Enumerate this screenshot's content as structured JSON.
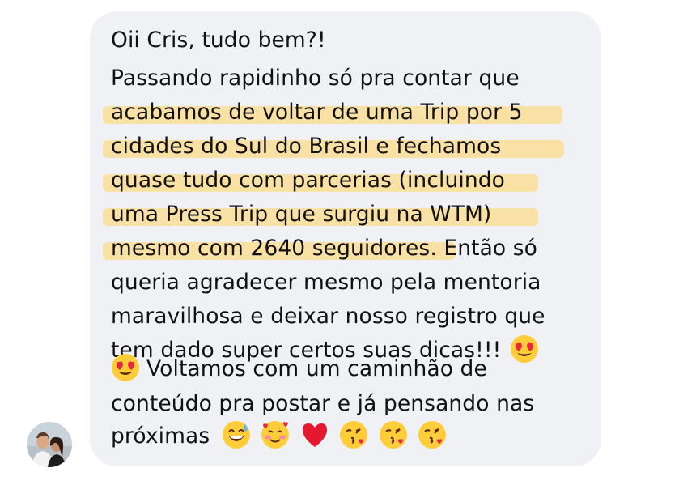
{
  "message": {
    "line1": "Oii Cris, tudo bem?!",
    "line2": "Passando rapidinho só pra contar que",
    "line3": "acabamos de voltar de uma Trip por 5",
    "line4": "cidades do Sul do Brasil e fechamos",
    "line5": "quase tudo com parcerias (incluindo",
    "line6": "uma Press Trip que surgiu na WTM)",
    "line7a": "mesmo com 2640 seguidores",
    "line7b": ". Então só",
    "line8": "queria agradecer mesmo pela mentoria",
    "line9": "maravilhosa e deixar nosso registro que",
    "line10": "tem dado super certos suas dicas!!!",
    "line11": "Voltamos com um caminhão de",
    "line12": "conteúdo pra postar e já pensando nas",
    "line13": "próximas"
  },
  "emojis": {
    "line10_end": "heart-eyes-emoji",
    "line11_start": "heart-eyes-emoji",
    "line13": [
      "grinning-sweat-emoji",
      "smiling-hearts-emoji",
      "red-heart-emoji",
      "kissing-heart-emoji",
      "kissing-heart-emoji",
      "kissing-heart-emoji"
    ]
  },
  "colors": {
    "bubble": "#eff1f4",
    "highlight": "#f9dfa0",
    "text": "#111111"
  },
  "avatar": "sender-avatar"
}
